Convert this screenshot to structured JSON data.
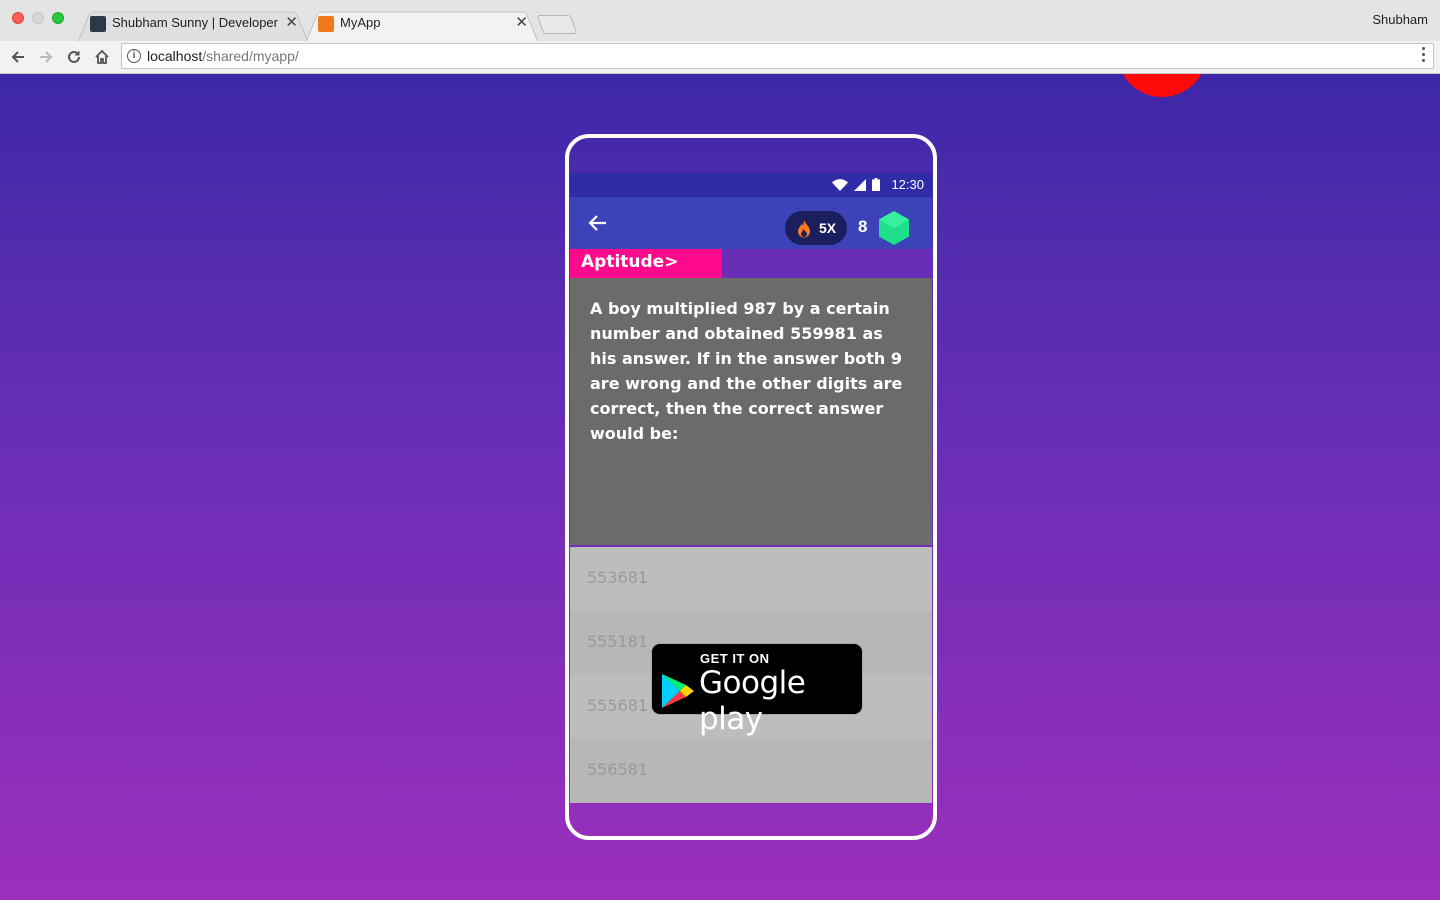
{
  "browser": {
    "tabs": [
      {
        "title": "Shubham Sunny | Developer |",
        "active": false
      },
      {
        "title": "MyApp",
        "active": true
      }
    ],
    "profile_name": "Shubham",
    "url_host": "localhost",
    "url_path": "/shared/myapp/"
  },
  "phone": {
    "status_time": "12:30",
    "streak_label": "5X",
    "score": "8",
    "category": "Aptitude>",
    "question": "A boy multiplied 987 by a certain number and obtained 559981 as his answer. If in the answer both 9 are wrong and the other digits are correct, then the correct answer would be:",
    "options": [
      "553681",
      "555181",
      "555681",
      "556581"
    ]
  },
  "badge": {
    "line1": "GET IT ON",
    "line2": "Google play"
  },
  "colors": {
    "page_gradient_top": "#3d28a8",
    "page_gradient_bottom": "#9b2fbc",
    "app_bar": "#3c43b8",
    "category_bg": "#ff0a8c",
    "question_bg": "#6b6b6b",
    "gem": "#1ee08a",
    "red_blob": "#ff0a0a"
  },
  "icons": [
    "back-arrow-icon",
    "forward-arrow-icon",
    "reload-icon",
    "home-icon",
    "info-icon",
    "menu-dots-icon",
    "wifi-icon",
    "signal-icon",
    "battery-icon",
    "flame-icon",
    "gem-icon",
    "play-logo-icon",
    "close-icon"
  ]
}
